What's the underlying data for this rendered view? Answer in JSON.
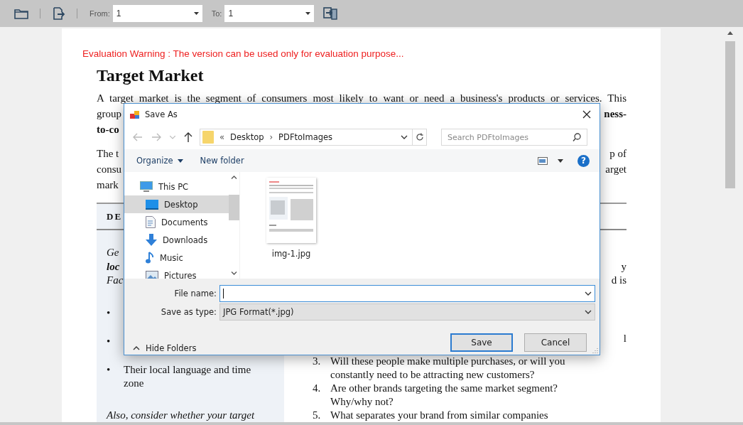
{
  "toolbar": {
    "from_label": "From:",
    "from_value": "1",
    "to_label": "To:",
    "to_value": "1"
  },
  "document": {
    "warning": "Evaluation Warning : The version can be used only for evaluation purpose...",
    "heading": "Target Market",
    "intro_line": "A target market is the segment of consumers most likely to want or need a business's products or services. This",
    "paragraphs": [
      [
        {
          "left": {
            "text": "group",
            "kind": "plain"
          },
          "right": {
            "text": "ness-",
            "kind": "bold"
          }
        },
        {
          "left": {
            "text": "to-co",
            "kind": "bold"
          }
        }
      ],
      [
        {
          "left": {
            "text": "The t",
            "kind": "plain"
          },
          "right": {
            "text": "p of",
            "kind": "plain"
          }
        },
        {
          "left": {
            "text": "consu",
            "kind": "plain"
          },
          "right": {
            "text": "arget",
            "kind": "plain"
          }
        },
        {
          "left": {
            "text": "mark",
            "kind": "plain"
          }
        }
      ]
    ],
    "table": {
      "header": "DE",
      "left_lines": [
        {
          "text": "Ge",
          "kind": "italic"
        },
        {
          "text": "loc",
          "kind": "bold-italic"
        },
        {
          "text": "Fac",
          "kind": "italic"
        }
      ],
      "bullets": [
        {
          "marker": "•"
        },
        {
          "marker": "•"
        },
        {
          "marker": "•",
          "text": "Their local language and time zone"
        }
      ],
      "note": "Also, consider whether your target",
      "right_fragments": [
        "y",
        "d is"
      ],
      "right_fragment_2": "l",
      "items": [
        {
          "number": "3.",
          "text": "Will these people make multiple purchases, or will you constantly need to be attracting new customers?"
        },
        {
          "number": "4.",
          "text": "Are other brands targeting the same market segment? Why/why not?"
        },
        {
          "number": "5.",
          "text": "What separates your brand from similar companies"
        }
      ]
    }
  },
  "dialog": {
    "title": "Save As",
    "breadcrumb": [
      {
        "text": "«",
        "kind": "separator"
      },
      {
        "text": "Desktop",
        "kind": "crumb"
      },
      {
        "text": "›",
        "kind": "separator"
      },
      {
        "text": "PDFtoImages",
        "kind": "crumb"
      }
    ],
    "search_placeholder": "Search PDFtoImages",
    "organize": "Organize",
    "new_folder": "New folder",
    "help": "?",
    "nav_items": [
      {
        "label": "This PC",
        "kind": "pc",
        "selected": false
      },
      {
        "label": "Desktop",
        "kind": "desktop",
        "selected": true
      },
      {
        "label": "Documents",
        "kind": "documents",
        "selected": false
      },
      {
        "label": "Downloads",
        "kind": "downloads",
        "selected": false
      },
      {
        "label": "Music",
        "kind": "music",
        "selected": false
      },
      {
        "label": "Pictures",
        "kind": "pictures",
        "selected": false
      }
    ],
    "files": [
      {
        "name": "img-1.jpg"
      }
    ],
    "file_name_label": "File name:",
    "type_label": "Save as type:",
    "type_value": "JPG Format(*.jpg)",
    "hide_folders": "Hide Folders",
    "buttons": [
      {
        "label": "Save",
        "default": true
      },
      {
        "label": "Cancel",
        "default": false
      }
    ]
  }
}
